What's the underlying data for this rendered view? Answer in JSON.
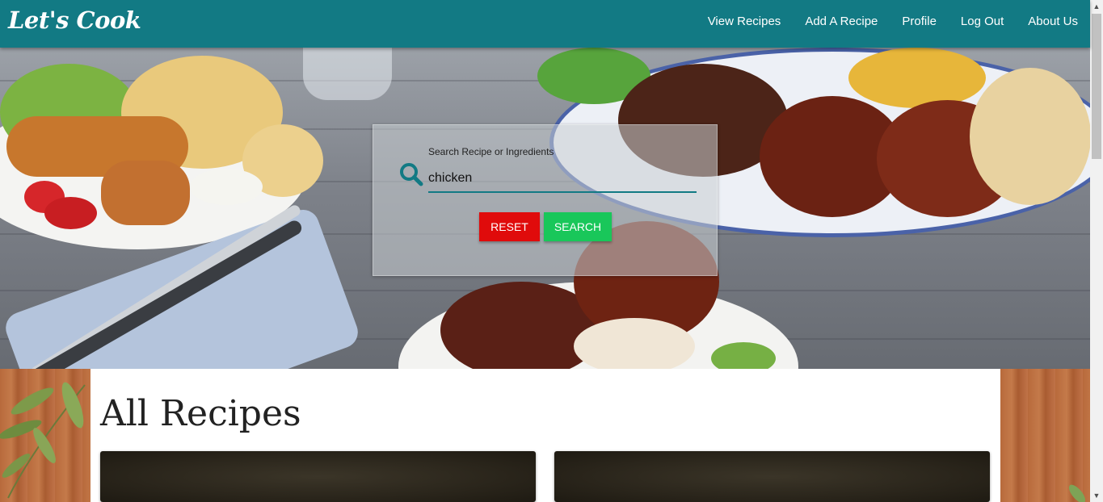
{
  "navbar": {
    "brand": "Let's Cook",
    "links": [
      "View Recipes",
      "Add A Recipe",
      "Profile",
      "Log Out",
      "About Us"
    ]
  },
  "search": {
    "label": "Search Recipe or Ingredients",
    "value": "chicken",
    "reset_label": "RESET",
    "search_label": "SEARCH"
  },
  "main": {
    "title": "All Recipes"
  },
  "icons": {
    "search": "search-icon",
    "scroll_up": "chevron-up-icon",
    "scroll_down": "chevron-down-icon"
  },
  "colors": {
    "primary": "#127a84",
    "reset": "#e00b0b",
    "search": "#19c75a"
  }
}
